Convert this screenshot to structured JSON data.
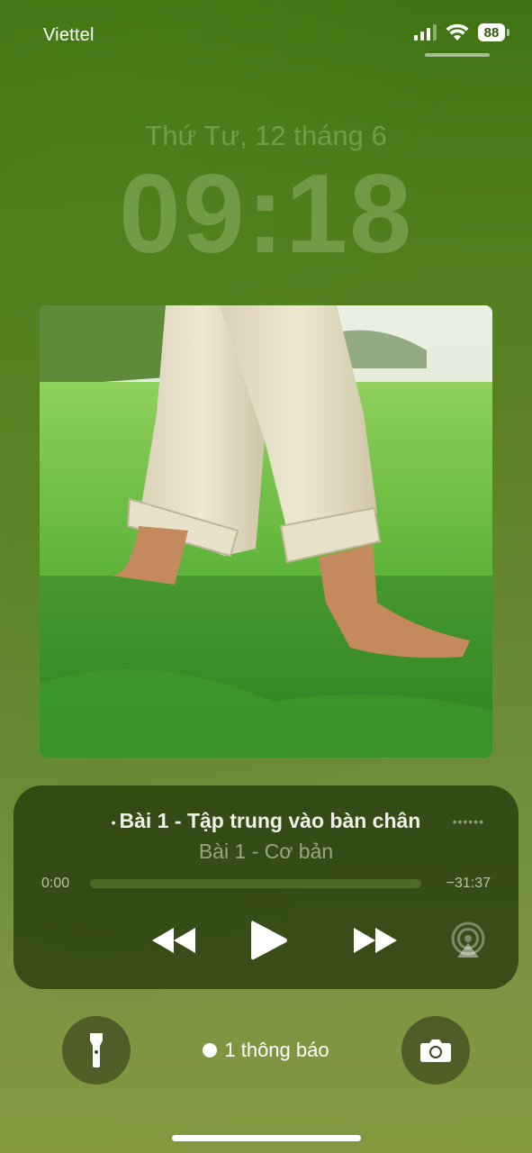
{
  "status_bar": {
    "carrier": "Viettel",
    "battery": "88",
    "signal_icon": "cellular-signal-icon",
    "wifi_icon": "wifi-icon"
  },
  "lock_screen": {
    "date": "Thứ Tư, 12 tháng 6",
    "time": "09:18"
  },
  "now_playing": {
    "title": "Bài 1 - Tập trung vào bàn chân",
    "subtitle": "Bài 1 - Cơ bản",
    "elapsed": "0:00",
    "remaining": "−31:37",
    "progress": 0.0,
    "controls": [
      "rewind-icon",
      "play-icon",
      "fast-forward-icon",
      "airplay-icon"
    ]
  },
  "bottom": {
    "notification_text": "1 thông báo",
    "flashlight_icon": "flashlight-icon",
    "camera_icon": "camera-icon"
  },
  "colors": {
    "background_top": "#3f7412",
    "background_bottom": "#83983f",
    "player_bg": "#1e3208"
  }
}
